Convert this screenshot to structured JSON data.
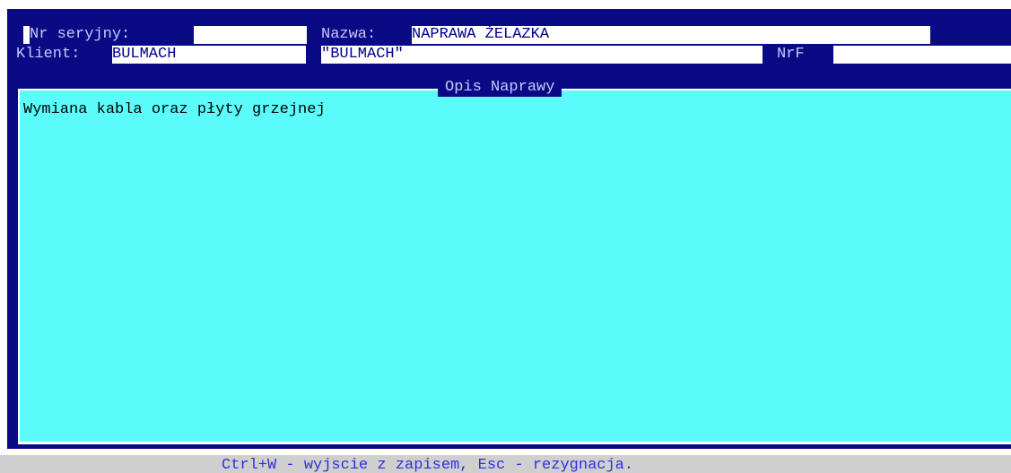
{
  "header": {
    "serial_label": "Nr seryjny:",
    "serial_value": "",
    "name_label": "Nazwa:",
    "name_value": "NAPRAWA ŻELAZKA",
    "client_label": "Klient:",
    "client_value": "BULMACH",
    "client_name": "\"BULMACH\"",
    "nrf_label": "NrF",
    "nrf_value": ""
  },
  "description": {
    "title": "Opis Naprawy",
    "text": "Wymiana kabla oraz płyty grzejnej"
  },
  "status": {
    "hint": "Ctrl+W - wyjscie z zapisem, Esc - rezygnacja."
  }
}
